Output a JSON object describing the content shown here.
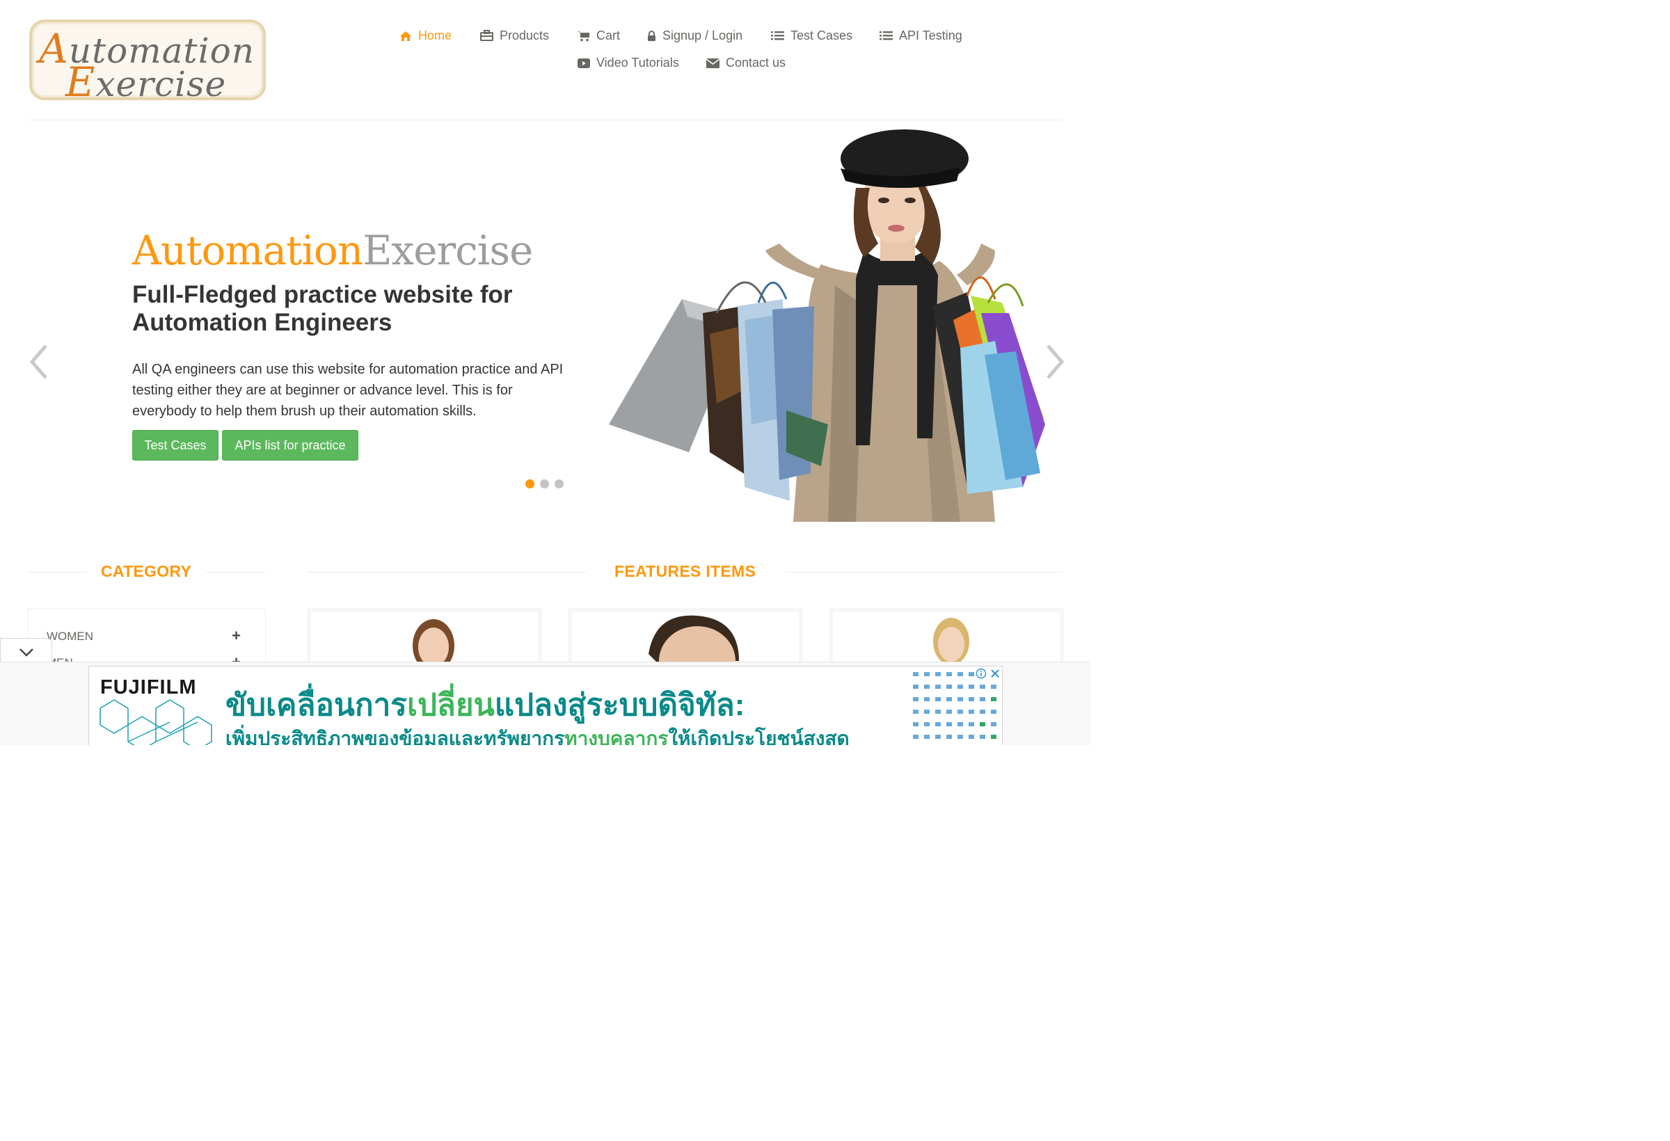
{
  "logo": {
    "line1_cap": "A",
    "line1_rest": "utomation",
    "line2_cap": "E",
    "line2_rest": "xercise"
  },
  "nav": {
    "items": [
      {
        "label": "Home",
        "icon": "home-icon",
        "active": true
      },
      {
        "label": "Products",
        "icon": "briefcase-icon"
      },
      {
        "label": "Cart",
        "icon": "cart-icon"
      },
      {
        "label": "Signup / Login",
        "icon": "lock-icon"
      },
      {
        "label": "Test Cases",
        "icon": "list-icon"
      },
      {
        "label": "API Testing",
        "icon": "list-icon"
      },
      {
        "label": "Video Tutorials",
        "icon": "youtube-play-icon"
      },
      {
        "label": "Contact us",
        "icon": "envelope-icon"
      }
    ]
  },
  "hero": {
    "brand_a": "Automation",
    "brand_b": "Exercise",
    "title": "Full-Fledged practice website for Automation Engineers",
    "text": "All QA engineers can use this website for automation practice and API testing either they are at beginner or advance level. This is for everybody to help them brush up their automation skills.",
    "btn_test_cases": "Test Cases",
    "btn_apis": "APIs list for practice",
    "slide_count": 3,
    "active_slide": 1
  },
  "sections": {
    "category": "CATEGORY",
    "features": "FEATURES ITEMS"
  },
  "category": {
    "items": [
      {
        "label": "WOMEN",
        "expand": "+"
      },
      {
        "label": "MEN",
        "expand": "+"
      }
    ]
  },
  "ad": {
    "brand": "FUJIFILM",
    "headline_a": "ขับเคลื่อนการ",
    "headline_b": "เปลี่ยน",
    "headline_c": "แปลงสู่ระบบดิจิทัล:",
    "sub_a": "เพิ่มประสิทธิภาพของข้อมูลและทรัพยากร",
    "sub_b": "ทางบุคลากร",
    "sub_c": "ให้เกิดประโยชน์สูงสุด"
  },
  "colors": {
    "accent": "#fe980f",
    "button_green": "#5cb85c",
    "text": "#696763",
    "heading": "#363432",
    "ad_teal": "#0a8a8a"
  }
}
